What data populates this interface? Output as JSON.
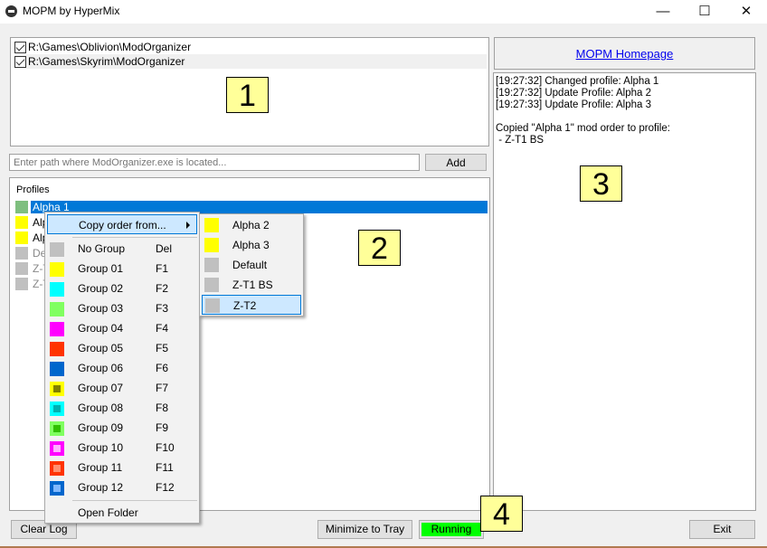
{
  "window": {
    "title": "MOPM by HyperMix",
    "minimize_icon": "minimize-icon",
    "maximize_icon": "maximize-icon",
    "close_icon": "close-icon"
  },
  "game_paths": [
    {
      "path": "R:\\Games\\Oblivion\\ModOrganizer",
      "checked": true
    },
    {
      "path": "R:\\Games\\Skyrim\\ModOrganizer",
      "checked": true
    }
  ],
  "path_input": {
    "value": "",
    "placeholder": "Enter path where ModOrganizer.exe is located..."
  },
  "add_button": "Add",
  "profiles": {
    "label": "Profiles",
    "items": [
      {
        "name": "Alpha 1",
        "color": "#7fbf7f",
        "selected": true
      },
      {
        "name": "Alpha 2",
        "color": "#ffff00"
      },
      {
        "name": "Alpha 3",
        "color": "#ffff00"
      },
      {
        "name": "Default",
        "color": "#c0c0c0",
        "dim": true
      },
      {
        "name": "Z-T1 BS",
        "color": "#c0c0c0",
        "dim": true
      },
      {
        "name": "Z-T2",
        "color": "#c0c0c0",
        "dim": true
      }
    ]
  },
  "context_menu": {
    "copy_order": "Copy order from...",
    "items": [
      {
        "label": "No Group",
        "key": "Del",
        "color": "#c0c0c0"
      },
      {
        "label": "Group 01",
        "key": "F1",
        "color": "#ffff00"
      },
      {
        "label": "Group 02",
        "key": "F2",
        "color": "#00ffff"
      },
      {
        "label": "Group 03",
        "key": "F3",
        "color": "#80ff60"
      },
      {
        "label": "Group 04",
        "key": "F4",
        "color": "#ff00ff"
      },
      {
        "label": "Group 05",
        "key": "F5",
        "color": "#ff3300"
      },
      {
        "label": "Group 06",
        "key": "F6",
        "color": "#0066cc"
      },
      {
        "label": "Group 07",
        "key": "F7",
        "color": "#ffff00",
        "inner": "#808000"
      },
      {
        "label": "Group 08",
        "key": "F8",
        "color": "#00ffff",
        "inner": "#00b0b0"
      },
      {
        "label": "Group 09",
        "key": "F9",
        "color": "#80ff60",
        "inner": "#30c000"
      },
      {
        "label": "Group 10",
        "key": "F10",
        "color": "#ff00ff",
        "inner": "#ffb0ff"
      },
      {
        "label": "Group 11",
        "key": "F11",
        "color": "#ff3300",
        "inner": "#ff9070"
      },
      {
        "label": "Group 12",
        "key": "F12",
        "color": "#0066cc",
        "inner": "#80b8ff"
      }
    ],
    "open_folder": "Open Folder"
  },
  "submenu": [
    {
      "label": "Alpha 2",
      "color": "#ffff00"
    },
    {
      "label": "Alpha 3",
      "color": "#ffff00"
    },
    {
      "label": "Default",
      "color": "#c0c0c0"
    },
    {
      "label": "Z-T1 BS",
      "color": "#c0c0c0"
    },
    {
      "label": "Z-T2",
      "color": "#c0c0c0",
      "highlighted": true
    }
  ],
  "homepage_link": "MOPM Homepage",
  "log": "[19:27:32] Changed profile: Alpha 1\n[19:27:32] Update Profile: Alpha 2\n[19:27:33] Update Profile: Alpha 3\n\nCopied \"Alpha 1\" mod order to profile:\n - Z-T1 BS",
  "buttons": {
    "clear_log": "Clear Log",
    "minimize_to_tray": "Minimize to Tray",
    "status": "Running",
    "exit": "Exit"
  },
  "annotations": [
    "1",
    "2",
    "3",
    "4"
  ]
}
